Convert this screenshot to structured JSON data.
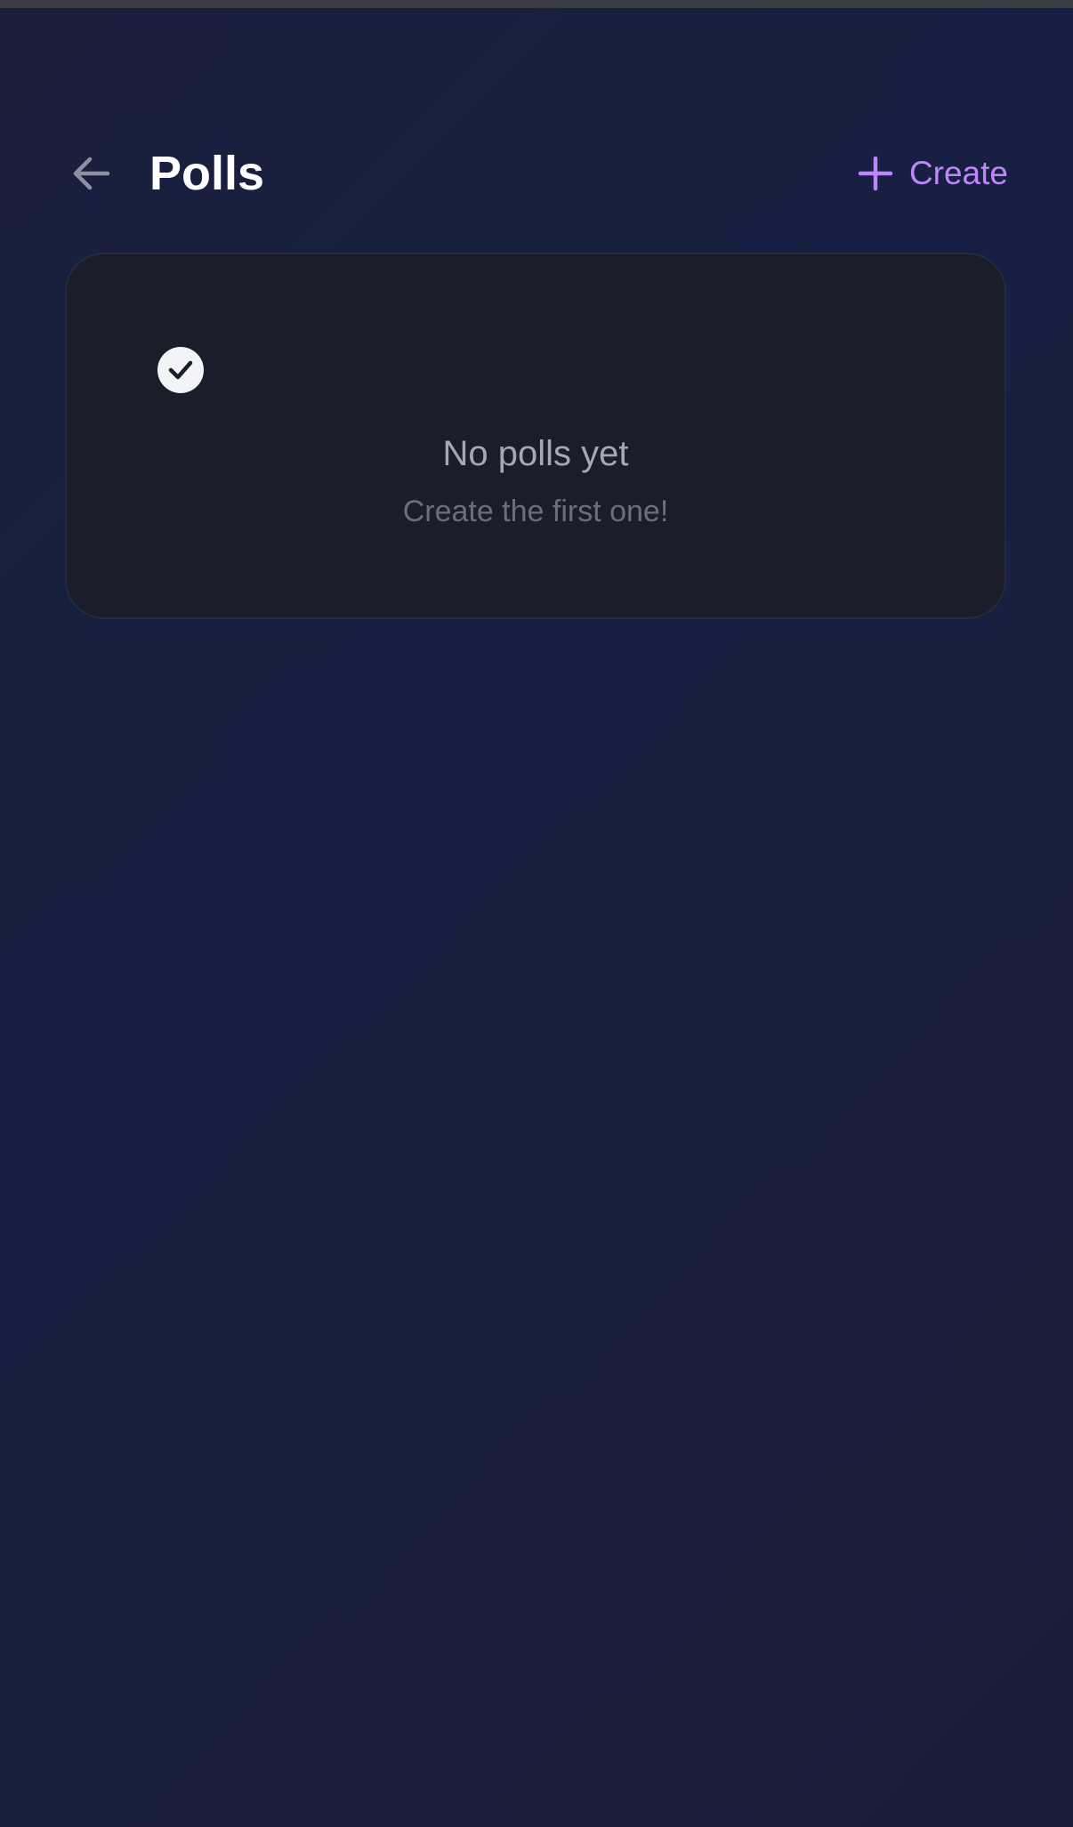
{
  "header": {
    "back_icon": "arrow-left-icon",
    "title": "Polls",
    "create_icon": "plus-icon",
    "create_label": "Create"
  },
  "empty_state": {
    "icon": "check-circle-icon",
    "title": "No polls yet",
    "subtitle": "Create the first one!"
  },
  "colors": {
    "accent": "#c084fc",
    "background": "#172043",
    "card": "#1b1d2b",
    "title_text": "#ffffff",
    "muted_text": "#a4a7b4"
  }
}
